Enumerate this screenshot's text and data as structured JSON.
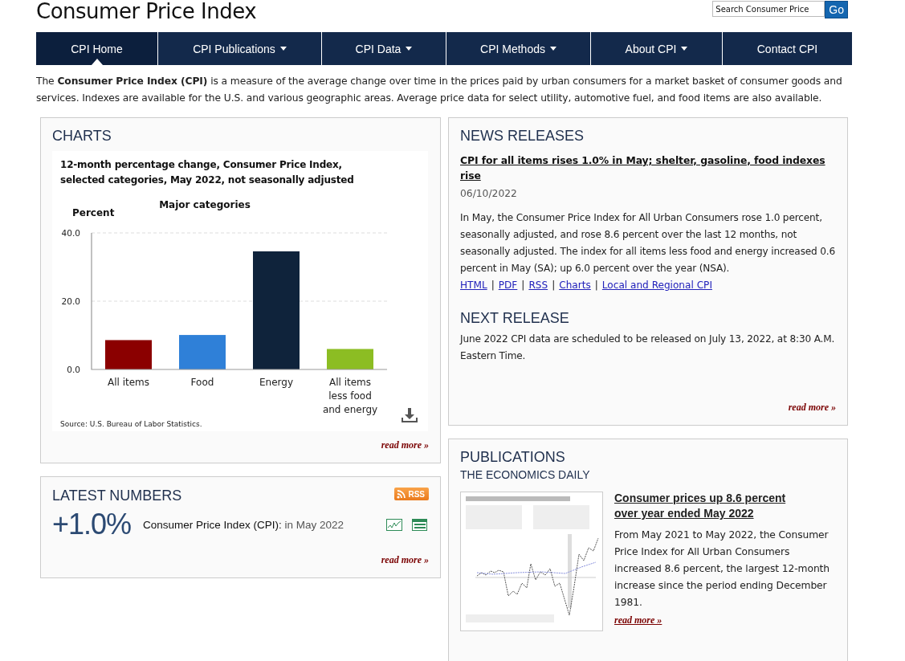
{
  "header": {
    "title": "Consumer Price Index",
    "search": {
      "placeholder": "Search Consumer Price",
      "button": "Go"
    }
  },
  "nav": [
    {
      "label": "CPI Home",
      "dropdown": false,
      "selected": true
    },
    {
      "label": "CPI Publications",
      "dropdown": true,
      "selected": false
    },
    {
      "label": "CPI Data",
      "dropdown": true,
      "selected": false
    },
    {
      "label": "CPI Methods",
      "dropdown": true,
      "selected": false
    },
    {
      "label": "About CPI",
      "dropdown": true,
      "selected": false
    },
    {
      "label": "Contact CPI",
      "dropdown": false,
      "selected": false
    }
  ],
  "intro": "The **Consumer Price Index (CPI)** is a measure of the average change over time in the prices paid by urban consumers for a market basket of consumer goods and services. Indexes are available for the U.S. and various geographic areas. Average price data for select utility, automotive fuel, and food items are also available.",
  "charts": {
    "heading": "CHARTS",
    "source": "Source: U.S. Bureau of Labor Statistics.",
    "read_more": "read more »",
    "chart_data": {
      "type": "bar",
      "title": "12-month percentage change, Consumer Price Index, selected categories, May 2022, not seasonally adjusted",
      "ylabel": "Percent",
      "categories": [
        "All items",
        "Food",
        "Energy",
        "All items less food and energy"
      ],
      "series": [
        {
          "name": "Major categories",
          "values": [
            8.6,
            10.1,
            34.6,
            6.0
          ]
        }
      ],
      "colors": [
        "#8b0000",
        "#2f80d8",
        "#0f233b",
        "#8cbd23"
      ],
      "ylim": [
        0,
        40
      ],
      "yticks": [
        {
          "value": 0,
          "label": "0.0"
        },
        {
          "value": 20,
          "label": "20.0"
        },
        {
          "value": 40,
          "label": "40.0"
        }
      ]
    }
  },
  "latest": {
    "heading": "LATEST NUMBERS",
    "rss": "RSS",
    "value": "+1.0%",
    "label": "Consumer Price Index (CPI):",
    "period": "in May 2022",
    "read_more": "read more »"
  },
  "news": {
    "heading": "NEWS RELEASES",
    "headline": "CPI for all items rises 1.0% in May; shelter, gasoline, food indexes rise",
    "date": "06/10/2022",
    "body": "In May, the Consumer Price Index for All Urban Consumers rose 1.0 percent, seasonally adjusted, and rose 8.6 percent over the last 12 months, not seasonally adjusted. The index for all items less food and energy increased 0.6 percent in May (SA); up 6.0 percent over the year (NSA).",
    "links": [
      "HTML",
      "PDF",
      "RSS",
      "Charts",
      "Local and Regional CPI"
    ],
    "separator": "|",
    "next_heading": "NEXT RELEASE",
    "next_body": "June 2022 CPI data are scheduled to be released on July 13, 2022, at 8:30 A.M. Eastern Time.",
    "read_more": "read more »"
  },
  "publications": {
    "heading": "PUBLICATIONS",
    "subheading": "THE ECONOMICS DAILY",
    "headline": "Consumer prices up 8.6 percent over year ended May 2022",
    "body": "From May 2021 to May 2022, the Consumer Price Index for All Urban Consumers increased 8.6 percent, the largest 12-month increase since the period ending December 1981.",
    "read_more": "read more »"
  }
}
